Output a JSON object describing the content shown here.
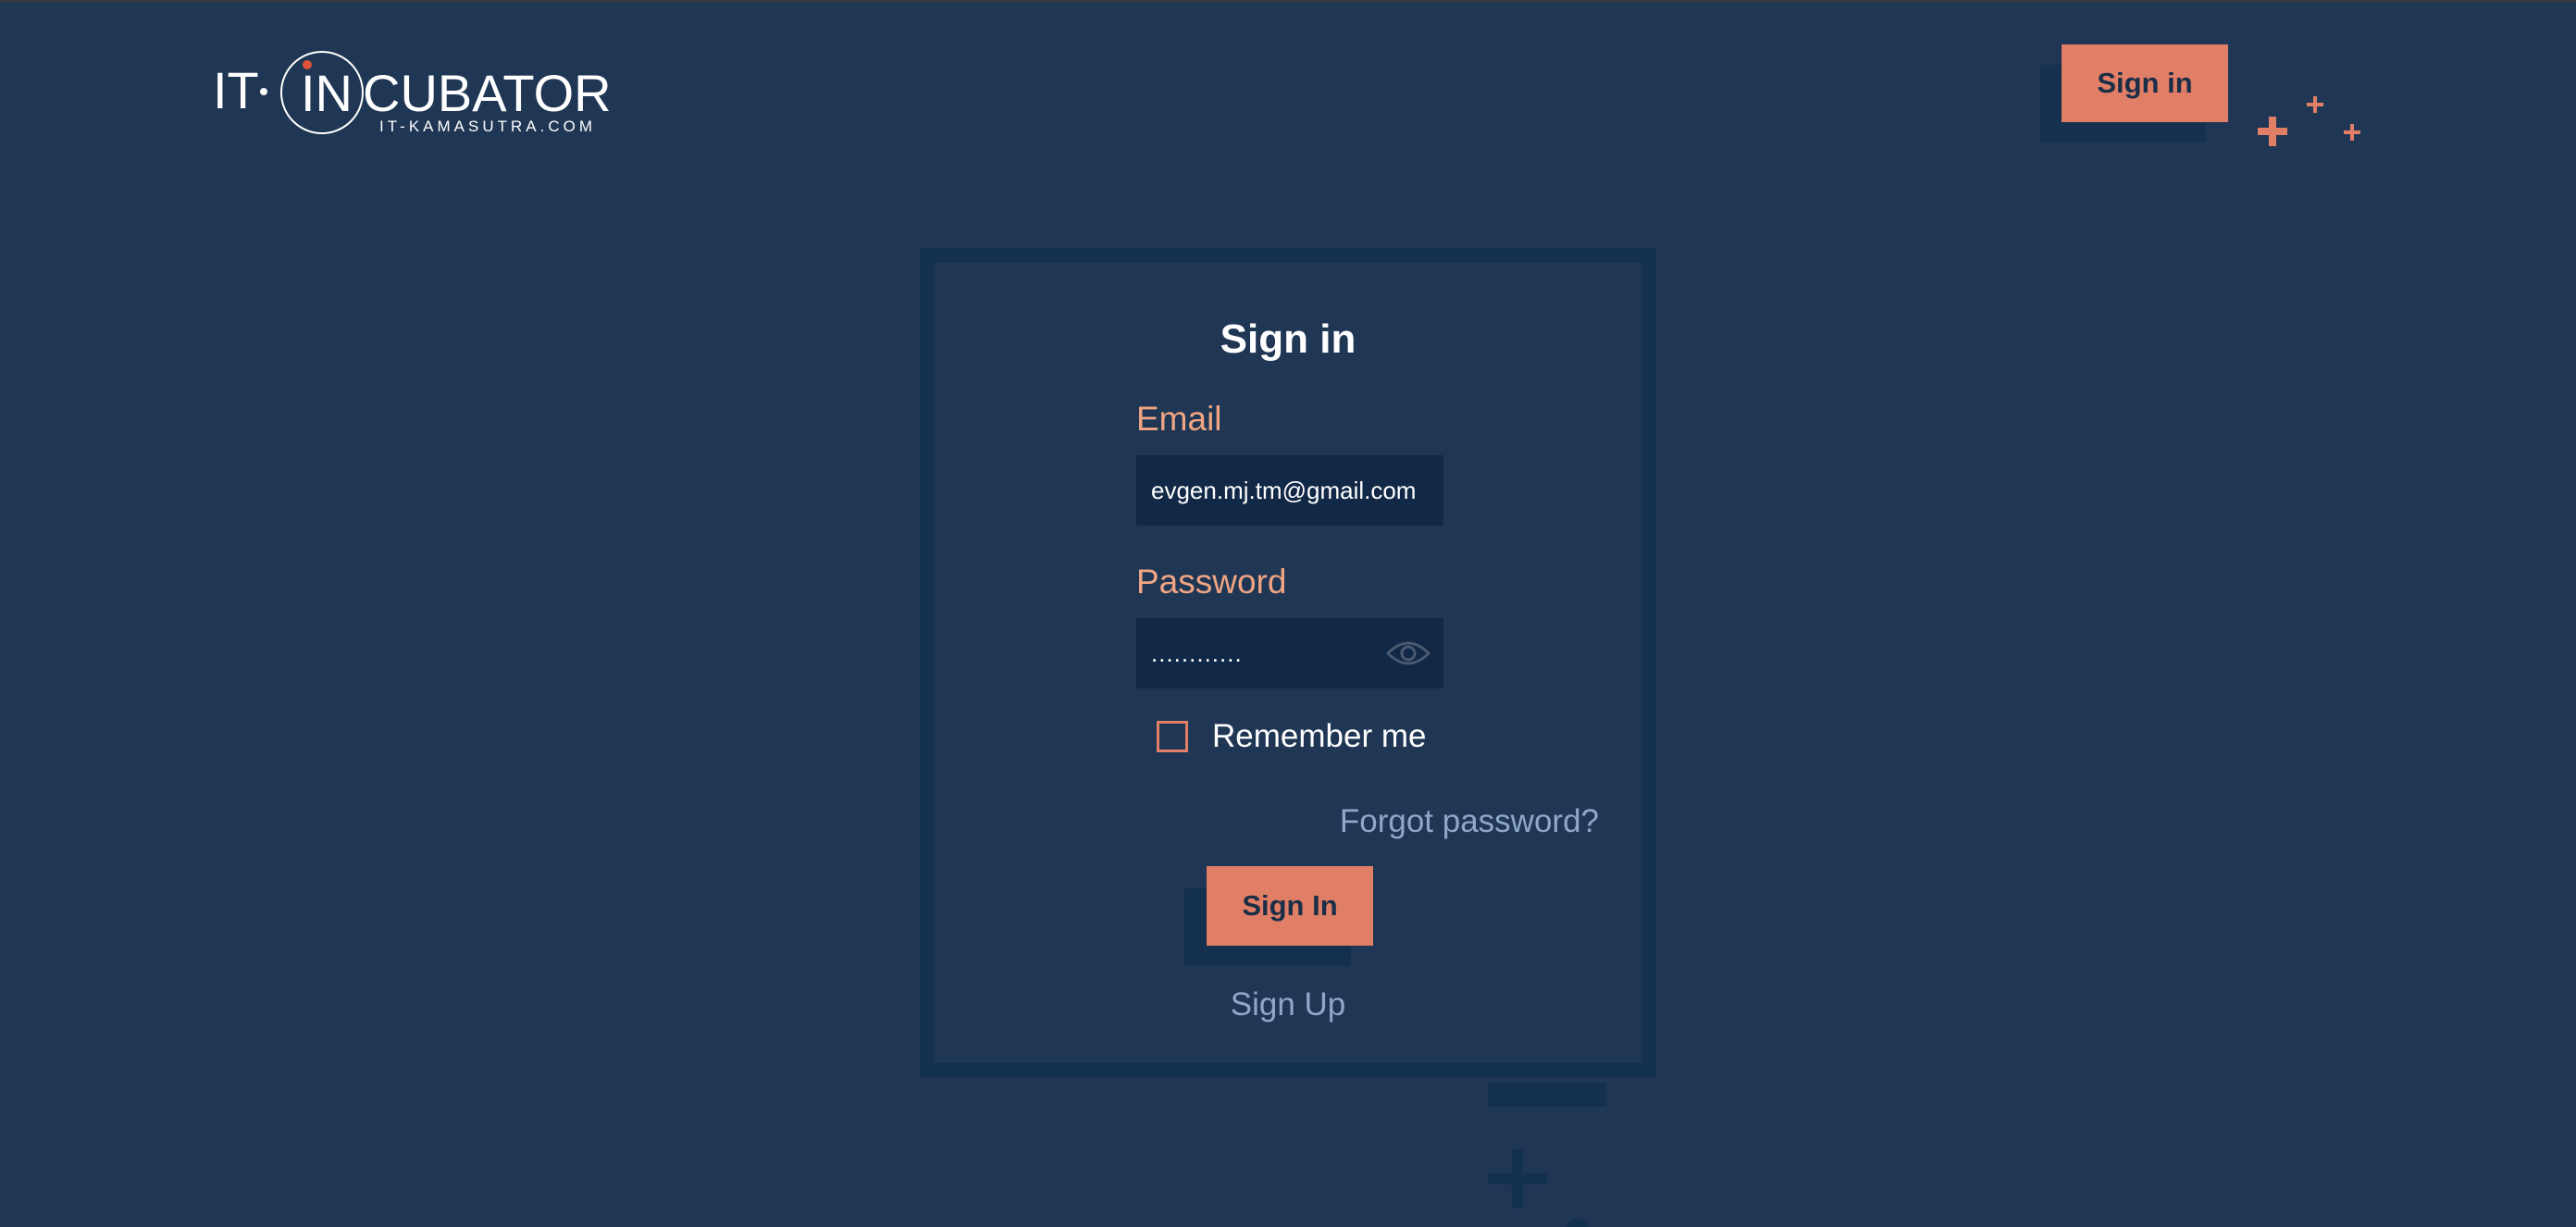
{
  "logo": {
    "text_left": "IT",
    "text_mid": "IN",
    "text_right": "CUBATOR",
    "subtitle": "IT-KAMASUTRA.COM"
  },
  "header": {
    "sign_in_label": "Sign in"
  },
  "form": {
    "title": "Sign in",
    "email_label": "Email",
    "email_value": "evgen.mj.tm@gmail.com",
    "password_label": "Password",
    "password_value": "............",
    "remember_label": "Remember me",
    "remember_checked": false,
    "forgot_label": "Forgot password?",
    "submit_label": "Sign In",
    "signup_label": "Sign Up"
  },
  "colors": {
    "background": "#1f3654",
    "card_border": "#14304f",
    "accent": "#e07e66",
    "label": "#f0a583",
    "link": "#8fa8c8"
  },
  "icons": [
    "eye-icon",
    "plus-icon"
  ]
}
